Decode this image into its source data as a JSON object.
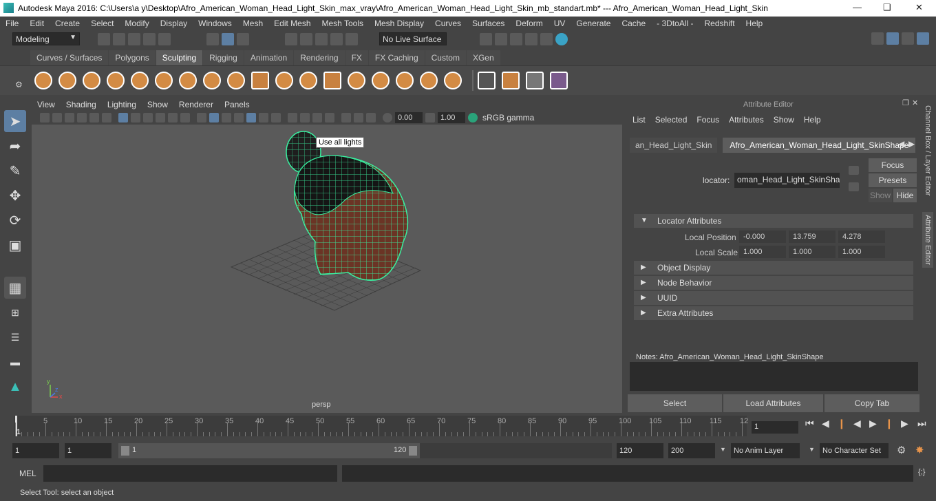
{
  "title": {
    "text": "Autodesk Maya 2016: C:\\Users\\a y\\Desktop\\Afro_American_Woman_Head_Light_Skin_max_vray\\Afro_American_Woman_Head_Light_Skin_mb_standart.mb*   ---   Afro_American_Woman_Head_Light_Skin"
  },
  "menus": [
    "File",
    "Edit",
    "Create",
    "Select",
    "Modify",
    "Display",
    "Windows",
    "Mesh",
    "Edit Mesh",
    "Mesh Tools",
    "Mesh Display",
    "Curves",
    "Surfaces",
    "Deform",
    "UV",
    "Generate",
    "Cache",
    "- 3DtoAll -",
    "Redshift",
    "Help"
  ],
  "status": {
    "mode": "Modeling",
    "live_surface": "No Live Surface"
  },
  "shelf_tabs": [
    {
      "label": "Curves / Surfaces",
      "active": false
    },
    {
      "label": "Polygons",
      "active": false
    },
    {
      "label": "Sculpting",
      "active": true
    },
    {
      "label": "Rigging",
      "active": false
    },
    {
      "label": "Animation",
      "active": false
    },
    {
      "label": "Rendering",
      "active": false
    },
    {
      "label": "FX",
      "active": false
    },
    {
      "label": "FX Caching",
      "active": false
    },
    {
      "label": "Custom",
      "active": false
    },
    {
      "label": "XGen",
      "active": false
    }
  ],
  "viewport": {
    "menu": [
      "View",
      "Shading",
      "Lighting",
      "Show",
      "Renderer",
      "Panels"
    ],
    "exposure": "0.00",
    "gamma": "1.00",
    "colorspace": "sRGB gamma",
    "tooltip": "Use all lights",
    "camera_label": "persp"
  },
  "attribute_editor": {
    "header": "Attribute Editor",
    "menu": [
      "List",
      "Selected",
      "Focus",
      "Attributes",
      "Show",
      "Help"
    ],
    "tabs": [
      "an_Head_Light_Skin",
      "Afro_American_Woman_Head_Light_SkinShape"
    ],
    "locator_label": "locator:",
    "locator_value": "oman_Head_Light_SkinShape",
    "buttons": {
      "focus": "Focus",
      "presets": "Presets",
      "show": "Show",
      "hide": "Hide"
    },
    "sections": {
      "locator": "Locator Attributes",
      "object_display": "Object Display",
      "node_behavior": "Node Behavior",
      "uuid": "UUID",
      "extra": "Extra Attributes"
    },
    "local_position": {
      "label": "Local Position",
      "x": "-0.000",
      "y": "13.759",
      "z": "4.278"
    },
    "local_scale": {
      "label": "Local Scale",
      "x": "1.000",
      "y": "1.000",
      "z": "1.000"
    },
    "notes_label": "Notes:  Afro_American_Woman_Head_Light_SkinShape",
    "bottom_buttons": {
      "select": "Select",
      "load": "Load Attributes",
      "copy": "Copy Tab"
    }
  },
  "side_tabs": {
    "channel_box": "Channel Box / Layer Editor",
    "attr_editor": "Attribute Editor"
  },
  "timeline": {
    "ticks": [
      "5",
      "10",
      "15",
      "20",
      "25",
      "30",
      "35",
      "40",
      "45",
      "50",
      "55",
      "60",
      "65",
      "70",
      "75",
      "80",
      "85",
      "90",
      "95",
      "100",
      "105",
      "110",
      "115",
      "12"
    ],
    "current_frame": "1",
    "frame_field": "1"
  },
  "range": {
    "start": "1",
    "start_inner": "1",
    "slider_start": "1",
    "slider_end": "120",
    "end": "120",
    "end_outer": "200",
    "anim_layer": "No Anim Layer",
    "char_set": "No Character Set"
  },
  "mel": {
    "label": "MEL"
  },
  "helpline": {
    "text": "Select Tool: select an object"
  }
}
